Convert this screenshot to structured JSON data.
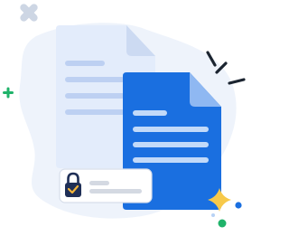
{
  "illustration": {
    "subject": "secure-documents",
    "icons": [
      "document-icon",
      "lock-icon",
      "check-icon",
      "sparkle-icon",
      "plus-icon",
      "cross-icon",
      "dot-icon"
    ]
  },
  "colors": {
    "background": "#ffffff",
    "blob": "#eef3fb",
    "doc_back": "#e3ecfb",
    "doc_back_fold": "#ccdaf2",
    "doc_back_lines": "#bdd0f2",
    "doc_front": "#1a6fe0",
    "doc_front_fold": "#8fb8f2",
    "doc_front_lines": "#c2daf9",
    "card": "#ffffff",
    "card_border": "#d7deea",
    "card_lines": "#d4d9e2",
    "lock_body": "#1f2f56",
    "lock_check": "#f3b53a",
    "star": "#f7c94a",
    "green_accent": "#20b36a",
    "blue_dot": "#1a6fe0",
    "light_blue_dot": "#b8d2f5",
    "cross": "#cdd6e4",
    "dash_marks": "#1b2430"
  }
}
